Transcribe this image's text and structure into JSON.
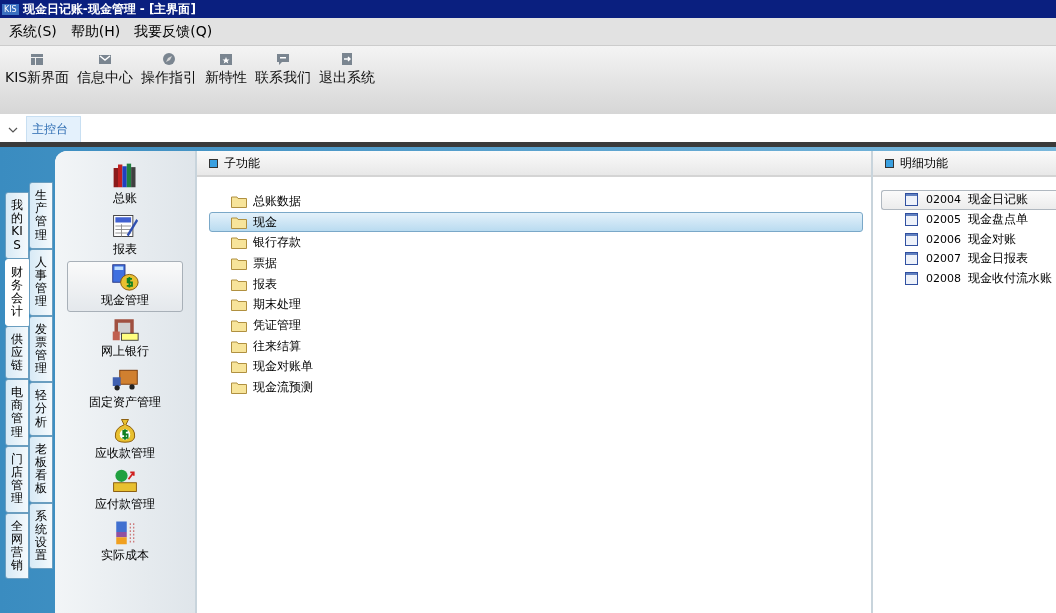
{
  "window": {
    "title": "现金日记账-现金管理 - [主界面]",
    "logo": "KIS"
  },
  "menu": [
    {
      "label": "系统(S)"
    },
    {
      "label": "帮助(H)"
    },
    {
      "label": "我要反馈(Q)"
    }
  ],
  "toolbar": [
    {
      "label": "KIS新界面",
      "kind": "layout"
    },
    {
      "label": "信息中心",
      "kind": "mail"
    },
    {
      "label": "操作指引",
      "kind": "compass"
    },
    {
      "label": "新特性",
      "kind": "star"
    },
    {
      "label": "联系我们",
      "kind": "chat"
    },
    {
      "label": "退出系统",
      "kind": "exit"
    }
  ],
  "tabs": [
    {
      "label": "主控台",
      "selected": true
    }
  ],
  "side_tabs_outer": [
    {
      "label": "我的KIS",
      "selected": false
    },
    {
      "label": "财务会计",
      "selected": true
    },
    {
      "label": "供应链",
      "selected": false
    },
    {
      "label": "电商管理",
      "selected": false
    },
    {
      "label": "门店管理",
      "selected": false
    },
    {
      "label": "全网营销",
      "selected": false
    }
  ],
  "side_tabs_inner": [
    {
      "label": "生产管理",
      "selected": false
    },
    {
      "label": "人事管理",
      "selected": false
    },
    {
      "label": "发票管理",
      "selected": false
    },
    {
      "label": "轻分析",
      "selected": false
    },
    {
      "label": "老板看板",
      "selected": false
    },
    {
      "label": "系统设置",
      "selected": false
    }
  ],
  "modules": [
    {
      "label": "总账",
      "kind": "books",
      "selected": false
    },
    {
      "label": "报表",
      "kind": "report",
      "selected": false
    },
    {
      "label": "现金管理",
      "kind": "cash",
      "selected": true
    },
    {
      "label": "网上银行",
      "kind": "bank",
      "selected": false
    },
    {
      "label": "固定资产管理",
      "kind": "truck",
      "selected": false
    },
    {
      "label": "应收款管理",
      "kind": "moneybag",
      "selected": false
    },
    {
      "label": "应付款管理",
      "kind": "payable",
      "selected": false
    },
    {
      "label": "实际成本",
      "kind": "cost",
      "selected": false
    }
  ],
  "sub_functions": {
    "title": "子功能",
    "items": [
      {
        "label": "总账数据",
        "selected": false
      },
      {
        "label": "现金",
        "selected": true
      },
      {
        "label": "银行存款",
        "selected": false
      },
      {
        "label": "票据",
        "selected": false
      },
      {
        "label": "报表",
        "selected": false
      },
      {
        "label": "期末处理",
        "selected": false
      },
      {
        "label": "凭证管理",
        "selected": false
      },
      {
        "label": "往来结算",
        "selected": false
      },
      {
        "label": "现金对账单",
        "selected": false
      },
      {
        "label": "现金流预测",
        "selected": false
      }
    ]
  },
  "detail_functions": {
    "title": "明细功能",
    "items": [
      {
        "code": "02004",
        "label": "现金日记账",
        "selected": true
      },
      {
        "code": "02005",
        "label": "现金盘点单",
        "selected": false
      },
      {
        "code": "02006",
        "label": "现金对账",
        "selected": false
      },
      {
        "code": "02007",
        "label": "现金日报表",
        "selected": false
      },
      {
        "code": "02008",
        "label": "现金收付流水账",
        "selected": false
      }
    ]
  }
}
